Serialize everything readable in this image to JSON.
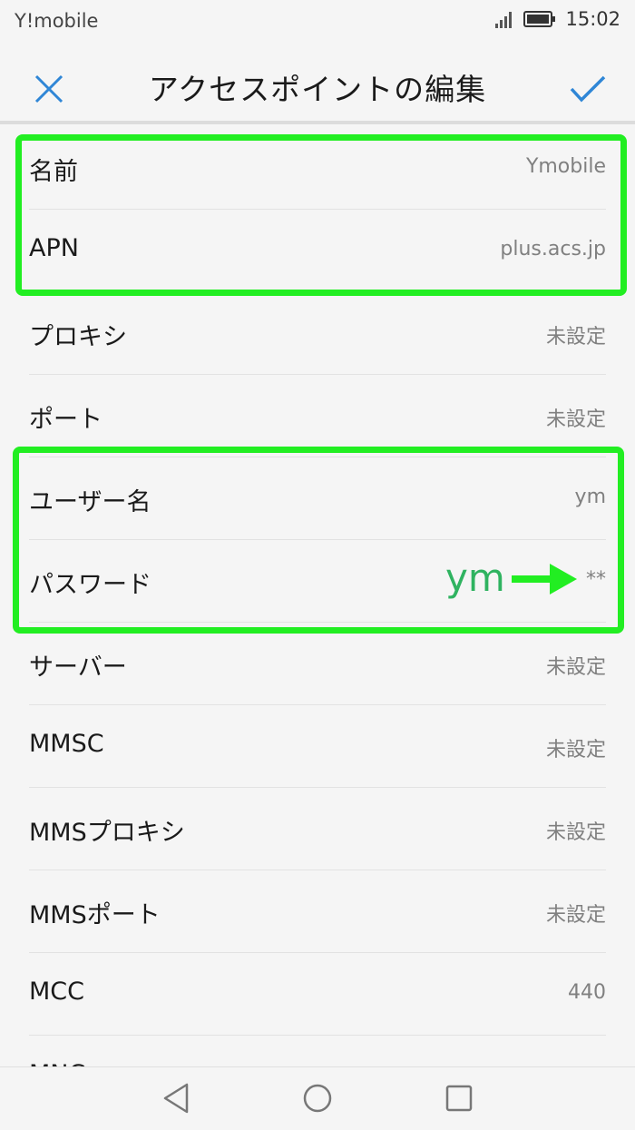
{
  "status_bar": {
    "carrier": "Y!mobile",
    "time": "15:02",
    "icons": [
      "signal-icon",
      "battery-icon"
    ]
  },
  "header": {
    "title": "アクセスポイントの編集",
    "close_icon": "close-icon",
    "confirm_icon": "check-icon",
    "accent_color": "#2f86d6"
  },
  "rows": [
    {
      "label": "名前",
      "value": "Ymobile"
    },
    {
      "label": "APN",
      "value": "plus.acs.jp"
    },
    {
      "label": "プロキシ",
      "value": "未設定"
    },
    {
      "label": "ポート",
      "value": "未設定"
    },
    {
      "label": "ユーザー名",
      "value": "ym"
    },
    {
      "label": "パスワード",
      "value": "**"
    },
    {
      "label": "サーバー",
      "value": "未設定"
    },
    {
      "label": "MMSC",
      "value": "未設定"
    },
    {
      "label": "MMSプロキシ",
      "value": "未設定"
    },
    {
      "label": "MMSポート",
      "value": "未設定"
    },
    {
      "label": "MCC",
      "value": "440"
    },
    {
      "label": "MNC",
      "value": ""
    }
  ],
  "annotation": {
    "text": "ym",
    "highlight_color": "#22ee22",
    "text_color": "#2fb360"
  },
  "nav_bar": {
    "icons": [
      "back-triangle-icon",
      "home-circle-icon",
      "recents-square-icon"
    ]
  }
}
